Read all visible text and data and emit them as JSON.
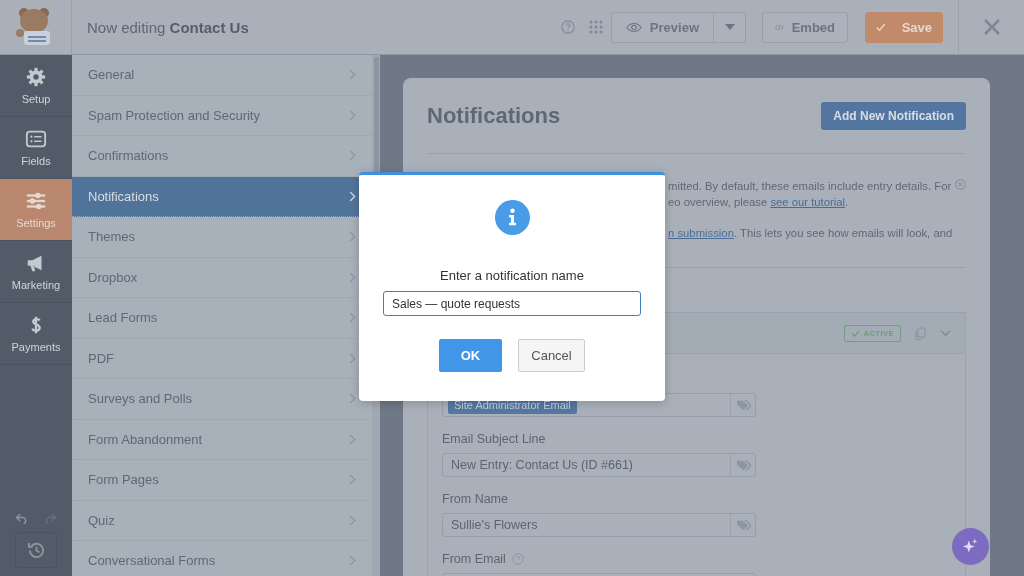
{
  "header": {
    "title": "Now editing **Contact Us**",
    "preview": "Preview",
    "embed": "Embed",
    "save": "Save"
  },
  "rail": {
    "items": [
      {
        "label": "Setup",
        "selected": false
      },
      {
        "label": "Fields",
        "selected": false
      },
      {
        "label": "Settings",
        "selected": true
      },
      {
        "label": "Marketing",
        "selected": false
      },
      {
        "label": "Payments",
        "selected": false
      }
    ]
  },
  "settings_menu": {
    "items": [
      {
        "label": "General",
        "selected": false
      },
      {
        "label": "Spam Protection and Security",
        "selected": false
      },
      {
        "label": "Confirmations",
        "selected": false
      },
      {
        "label": "Notifications",
        "selected": true
      },
      {
        "label": "Themes",
        "selected": false
      },
      {
        "label": "Dropbox",
        "selected": false
      },
      {
        "label": "Lead Forms",
        "selected": false
      },
      {
        "label": "PDF",
        "selected": false
      },
      {
        "label": "Surveys and Polls",
        "selected": false
      },
      {
        "label": "Form Abandonment",
        "selected": false
      },
      {
        "label": "Form Pages",
        "selected": false
      },
      {
        "label": "Quiz",
        "selected": false
      },
      {
        "label": "Conversational Forms",
        "selected": false
      }
    ]
  },
  "card": {
    "title": "Notifications",
    "add_button": "Add New Notification",
    "notice": [
      [
        {
          "text": "mitted. By default, these emails include entry details. For",
          "link": false
        }
      ],
      [
        {
          "text": "eo overview, please ",
          "link": false
        },
        {
          "text": "see our tutorial",
          "link": true
        },
        {
          "text": ".",
          "link": false
        }
      ],
      [
        {
          "text": "n submission",
          "link": true
        },
        {
          "text": ". This lets you see how emails will look, and",
          "link": false
        }
      ]
    ],
    "notification": {
      "badge": "ACTIVE",
      "fields": [
        {
          "chip": "Site Administrator Email"
        },
        {
          "label": "Email Subject Line",
          "value": "New Entry: Contact Us (ID #661)"
        },
        {
          "label": "From Name",
          "value": "Sullie's Flowers"
        },
        {
          "label": "From Email",
          "help": true
        }
      ]
    }
  },
  "modal": {
    "prompt": "Enter a notification name",
    "value": "Sales — quote requests",
    "buttons": [
      {
        "label": "OK",
        "kind": "primary"
      },
      {
        "label": "Cancel",
        "kind": "secondary"
      }
    ]
  }
}
